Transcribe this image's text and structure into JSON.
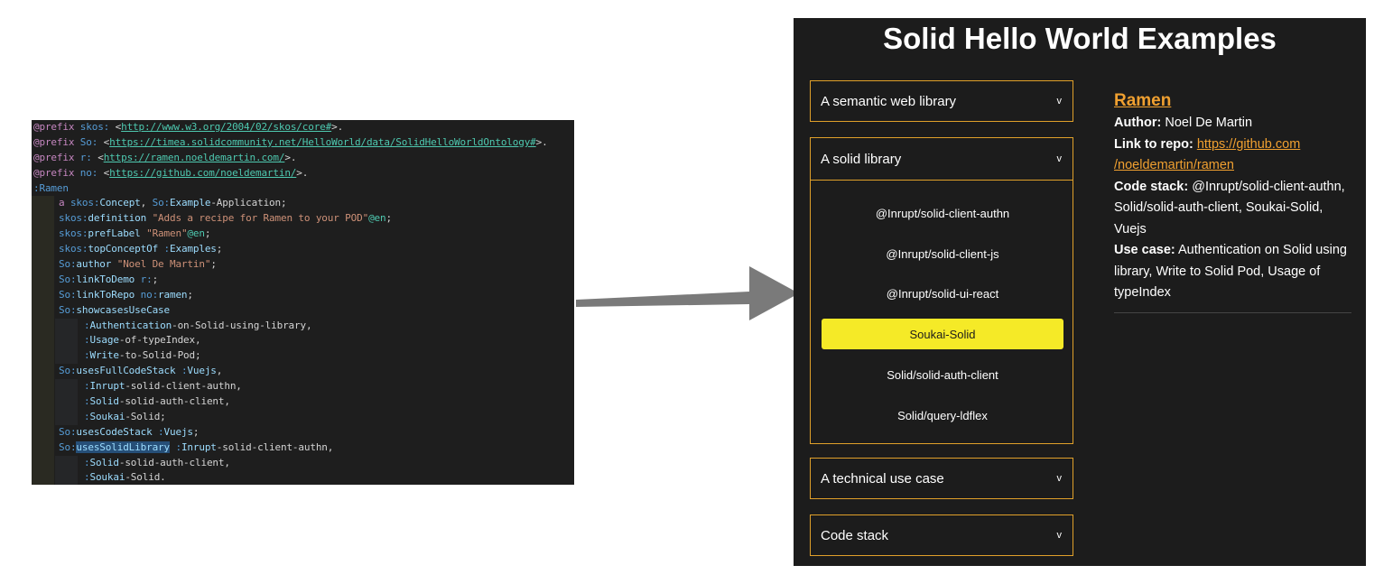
{
  "code": {
    "lines": [
      {
        "indent": 0,
        "tokens": [
          [
            "tok-prefix",
            "@prefix "
          ],
          [
            "tok-ns",
            "skos:"
          ],
          [
            "tok-punct",
            " <"
          ],
          [
            "tok-uri",
            "http://www.w3.org/2004/02/skos/core#"
          ],
          [
            "tok-punct",
            ">."
          ]
        ]
      },
      {
        "indent": 0,
        "tokens": [
          [
            "tok-prefix",
            "@prefix "
          ],
          [
            "tok-ns",
            "So:"
          ],
          [
            "tok-punct",
            " <"
          ],
          [
            "tok-uri",
            "https://timea.solidcommunity.net/HelloWorld/data/SolidHelloWorldOntology#"
          ],
          [
            "tok-punct",
            ">."
          ]
        ]
      },
      {
        "indent": 0,
        "tokens": [
          [
            "tok-prefix",
            "@prefix "
          ],
          [
            "tok-ns",
            "r:"
          ],
          [
            "tok-punct",
            " <"
          ],
          [
            "tok-uri",
            "https://ramen.noeldemartin.com/"
          ],
          [
            "tok-punct",
            ">."
          ]
        ]
      },
      {
        "indent": 0,
        "tokens": [
          [
            "tok-prefix",
            "@prefix "
          ],
          [
            "tok-ns",
            "no:"
          ],
          [
            "tok-punct",
            " <"
          ],
          [
            "tok-uri",
            "https://github.com/noeldemartin/"
          ],
          [
            "tok-punct",
            ">."
          ]
        ]
      },
      {
        "indent": 0,
        "tokens": [
          [
            "tok-ns",
            ":Ramen"
          ]
        ]
      },
      {
        "indent": 1,
        "tokens": [
          [
            "tok-prefix",
            "a "
          ],
          [
            "tok-ns",
            "skos:"
          ],
          [
            "tok-subj",
            "Concept"
          ],
          [
            "tok-punct",
            ", "
          ],
          [
            "tok-ns",
            "So:"
          ],
          [
            "tok-subj",
            "Example"
          ],
          [
            "tok-punct",
            "-Application;"
          ]
        ]
      },
      {
        "indent": 1,
        "tokens": [
          [
            "tok-ns",
            "skos:"
          ],
          [
            "tok-subj",
            "definition"
          ],
          [
            "tok-str",
            " \"Adds a recipe for Ramen to your POD\""
          ],
          [
            "tok-lang",
            "@en"
          ],
          [
            "tok-punct",
            ";"
          ]
        ]
      },
      {
        "indent": 1,
        "tokens": [
          [
            "tok-ns",
            "skos:"
          ],
          [
            "tok-subj",
            "prefLabel"
          ],
          [
            "tok-str",
            " \"Ramen\""
          ],
          [
            "tok-lang",
            "@en"
          ],
          [
            "tok-punct",
            ";"
          ]
        ]
      },
      {
        "indent": 1,
        "tokens": [
          [
            "tok-ns",
            "skos:"
          ],
          [
            "tok-subj",
            "topConceptOf"
          ],
          [
            "tok-ns",
            " :"
          ],
          [
            "tok-subj",
            "Examples"
          ],
          [
            "tok-punct",
            ";"
          ]
        ]
      },
      {
        "indent": 1,
        "tokens": [
          [
            "tok-ns",
            "So:"
          ],
          [
            "tok-subj",
            "author"
          ],
          [
            "tok-str",
            " \"Noel De Martin\""
          ],
          [
            "tok-punct",
            ";"
          ]
        ]
      },
      {
        "indent": 1,
        "tokens": [
          [
            "tok-ns",
            "So:"
          ],
          [
            "tok-subj",
            "linkToDemo"
          ],
          [
            "tok-ns",
            " r:"
          ],
          [
            "tok-punct",
            ";"
          ]
        ]
      },
      {
        "indent": 1,
        "tokens": [
          [
            "tok-ns",
            "So:"
          ],
          [
            "tok-subj",
            "linkToRepo"
          ],
          [
            "tok-ns",
            " no:"
          ],
          [
            "tok-subj",
            "ramen"
          ],
          [
            "tok-punct",
            ";"
          ]
        ]
      },
      {
        "indent": 1,
        "tokens": [
          [
            "tok-ns",
            "So:"
          ],
          [
            "tok-subj",
            "showcasesUseCase"
          ]
        ]
      },
      {
        "indent": 2,
        "tokens": [
          [
            "tok-ns",
            ":"
          ],
          [
            "tok-subj",
            "Authentication"
          ],
          [
            "tok-punct",
            "-on-Solid-using-library,"
          ]
        ]
      },
      {
        "indent": 2,
        "tokens": [
          [
            "tok-ns",
            ":"
          ],
          [
            "tok-subj",
            "Usage"
          ],
          [
            "tok-punct",
            "-of-typeIndex,"
          ]
        ]
      },
      {
        "indent": 2,
        "tokens": [
          [
            "tok-ns",
            ":"
          ],
          [
            "tok-subj",
            "Write"
          ],
          [
            "tok-punct",
            "-to-Solid-Pod;"
          ]
        ]
      },
      {
        "indent": 1,
        "tokens": [
          [
            "tok-ns",
            "So:"
          ],
          [
            "tok-subj",
            "usesFullCodeStack"
          ],
          [
            "tok-ns",
            " :"
          ],
          [
            "tok-subj",
            "Vuejs"
          ],
          [
            "tok-punct",
            ","
          ]
        ]
      },
      {
        "indent": 2,
        "tokens": [
          [
            "tok-ns",
            ":"
          ],
          [
            "tok-subj",
            "Inrupt"
          ],
          [
            "tok-punct",
            "-solid-client-authn,"
          ]
        ]
      },
      {
        "indent": 2,
        "tokens": [
          [
            "tok-ns",
            ":"
          ],
          [
            "tok-subj",
            "Solid"
          ],
          [
            "tok-punct",
            "-solid-auth-client,"
          ]
        ]
      },
      {
        "indent": 2,
        "tokens": [
          [
            "tok-ns",
            ":"
          ],
          [
            "tok-subj",
            "Soukai"
          ],
          [
            "tok-punct",
            "-Solid;"
          ]
        ]
      },
      {
        "indent": 1,
        "tokens": [
          [
            "tok-ns",
            "So:"
          ],
          [
            "tok-subj",
            "usesCodeStack"
          ],
          [
            "tok-ns",
            " :"
          ],
          [
            "tok-subj",
            "Vuejs"
          ],
          [
            "tok-punct",
            ";"
          ]
        ]
      },
      {
        "indent": 1,
        "tokens": [
          [
            "tok-ns",
            "So:"
          ],
          [
            "tok-subj hl",
            "usesSolidLibrary"
          ],
          [
            "tok-ns",
            " :"
          ],
          [
            "tok-subj",
            "Inrupt"
          ],
          [
            "tok-punct",
            "-solid-client-authn,"
          ]
        ]
      },
      {
        "indent": 2,
        "tokens": [
          [
            "tok-ns",
            ":"
          ],
          [
            "tok-subj",
            "Solid"
          ],
          [
            "tok-punct",
            "-solid-auth-client,"
          ]
        ]
      },
      {
        "indent": 2,
        "tokens": [
          [
            "tok-ns",
            ":"
          ],
          [
            "tok-subj",
            "Soukai"
          ],
          [
            "tok-punct",
            "-Solid."
          ]
        ]
      }
    ]
  },
  "app": {
    "title": "Solid Hello World Examples",
    "chevron": "v",
    "accordions": {
      "semantic": "A semantic web library",
      "solid": "A solid library",
      "usecase": "A technical use case",
      "codestack": "Code stack"
    },
    "libraries": [
      "@Inrupt/solid-client-authn",
      "@Inrupt/solid-client-js",
      "@Inrupt/solid-ui-react",
      "Soukai-Solid",
      "Solid/solid-auth-client",
      "Solid/query-ldflex"
    ],
    "selected_library": "Soukai-Solid",
    "detail": {
      "title": "Ramen",
      "author_label": "Author:",
      "author": "Noel De Martin",
      "repo_label": "Link to repo:",
      "repo_link_line1": "https://github.com",
      "repo_link_line2": "/noeldemartin/ramen",
      "stack_label": "Code stack:",
      "stack": "@Inrupt/solid-client-authn, Solid/solid-auth-client, Soukai-Solid, Vuejs",
      "usecase_label": "Use case:",
      "usecase": "Authentication on Solid using library, Write to Solid Pod, Usage of typeIndex"
    },
    "colors": {
      "accent": "#e0a02a",
      "link": "#f0a030",
      "selected": "#f5ea27",
      "panel_bg": "#1c1c1c"
    }
  }
}
